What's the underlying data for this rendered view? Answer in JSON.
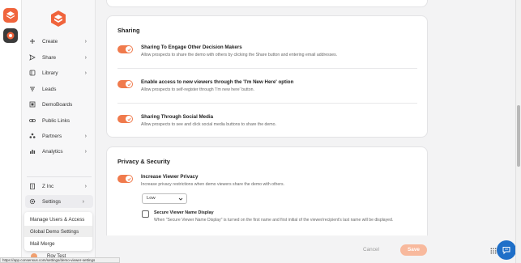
{
  "colors": {
    "accent": "#f07a4c",
    "save_disabled": "#f8b99d",
    "chat": "#1f6fc8"
  },
  "rail": {
    "apps": [
      {
        "icon": "app-icon-orange"
      },
      {
        "icon": "app-icon-dark"
      }
    ]
  },
  "sidebar": {
    "logo_icon": "brand-logo-icon",
    "items": [
      {
        "label": "Create",
        "icon": "plus-icon",
        "chevron": "›"
      },
      {
        "label": "Share",
        "icon": "send-icon",
        "chevron": "›"
      },
      {
        "label": "Library",
        "icon": "library-icon",
        "chevron": "›"
      },
      {
        "label": "Leads",
        "icon": "filter-icon",
        "chevron": ""
      },
      {
        "label": "DemoBoards",
        "icon": "board-icon",
        "chevron": ""
      },
      {
        "label": "Public Links",
        "icon": "link-icon",
        "chevron": ""
      },
      {
        "label": "Partners",
        "icon": "partners-icon",
        "chevron": "›"
      },
      {
        "label": "Analytics",
        "icon": "analytics-icon",
        "chevron": "›"
      }
    ],
    "org": {
      "label": "Z Inc",
      "icon": "building-icon",
      "chevron": "›"
    },
    "settings": {
      "label": "Settings",
      "icon": "gear-icon",
      "chevron": "›"
    },
    "settings_menu": [
      "Manage Users & Access",
      "Global Demo Settings",
      "Mail Merge"
    ],
    "user": {
      "name": "Roy Test",
      "chevron": "›"
    }
  },
  "status_bar": {
    "url": "https://app.consensus.com/settings/demo-viewer-settings"
  },
  "sharing": {
    "title": "Sharing",
    "options": [
      {
        "title": "Sharing To Engage Other Decision Makers",
        "desc": "Allow prospects to share the demo with others by clicking the Share button and entering email addresses.",
        "enabled": true
      },
      {
        "title": "Enable access to new viewers through the 'I'm New Here' option",
        "desc": "Allow prospects to self-register through 'I'm new here' button.",
        "enabled": true
      },
      {
        "title": "Sharing Through Social Media",
        "desc": "Allow prospects to see and click social media buttons to share the demo.",
        "enabled": true
      }
    ]
  },
  "privacy": {
    "title": "Privacy & Security",
    "increase": {
      "title": "Increase Viewer Privacy",
      "desc": "Increase privacy restrictions when demo viewers share the demo with others.",
      "enabled": true
    },
    "level": {
      "value": "Low"
    },
    "secure_display": {
      "title": "Secure Viewer Name Display",
      "desc": "When \"Secure Viewer Name Display\" is turned on the first name and first initial of the viewer/recipient's last name will be displayed.",
      "checked": false
    }
  },
  "footer": {
    "cancel": "Cancel",
    "save": "Save"
  }
}
